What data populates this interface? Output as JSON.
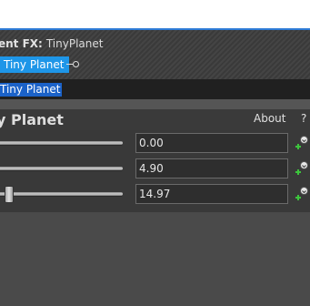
{
  "fx_header": {
    "label": "ent FX:",
    "effect_name": "TinyPlanet",
    "chip_label": "Tiny Planet"
  },
  "stack": {
    "selected_item": "Tiny Planet"
  },
  "panel": {
    "title": "y Planet",
    "about_label": "About",
    "help_label": "?"
  },
  "parameters": [
    {
      "value": "0.00",
      "slider_fraction": null
    },
    {
      "value": "4.90",
      "slider_fraction": null
    },
    {
      "value": "14.97",
      "slider_fraction": 0.07
    }
  ],
  "colors": {
    "chip": "#1e96e8",
    "selection": "#1b62c8",
    "keyframe_plus": "#3cc43c"
  },
  "icons": {
    "keyframe": "keyframe-plus-icon",
    "connector": "connector-icon"
  }
}
